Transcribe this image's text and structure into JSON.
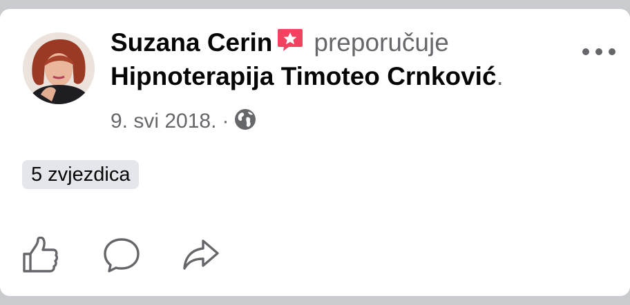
{
  "post": {
    "author": "Suzana Cerin",
    "verb": "preporučuje",
    "page": "Hipnoterapija Timoteo Crnković",
    "page_suffix": ".",
    "date": "9. svi 2018.",
    "separator": "·",
    "audience_icon": "globe-icon",
    "recommend_icon": "recommendation-star-icon",
    "rating_badge": "5 zvjezdica"
  },
  "actions": {
    "like_icon": "thumbs-up-icon",
    "comment_icon": "comment-bubble-icon",
    "share_icon": "share-arrow-icon"
  },
  "colors": {
    "recommend_accent": "#f3425f",
    "secondary_text": "#65676b",
    "badge_bg": "#e4e6eb"
  }
}
